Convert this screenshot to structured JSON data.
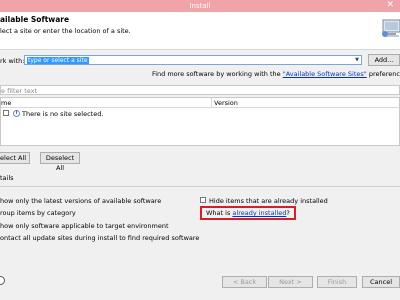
{
  "window": {
    "title": "Install",
    "close_glyph": "✕"
  },
  "header": {
    "title": "ailable Software",
    "subtitle": "lect a site or enter the location of a site.",
    "icon": "install-wizard-icon"
  },
  "work_with": {
    "label": "rk with:",
    "placeholder": "type or select a site",
    "add_label": "Add..."
  },
  "find_more": {
    "prefix": "Find more software by working with the ",
    "link": "\"Available Software Sites\"",
    "suffix": " preferenc"
  },
  "filter": {
    "placeholder": "e filter text"
  },
  "table": {
    "columns": [
      "me",
      "Version"
    ],
    "message": "There is no site selected."
  },
  "buttons": {
    "select_all": "Select All",
    "deselect_all": "Deselect All"
  },
  "details": {
    "label": "tails"
  },
  "options": {
    "latest_versions": "how only the latest versions of available software",
    "hide_installed": "Hide items that are already installed",
    "group_by_category": "roup items by category",
    "what_prefix": "What is ",
    "what_link": "already installed",
    "what_suffix": "?",
    "target_env": "how only software applicable to target environment",
    "contact_all": "ontact all update sites during install to find required software"
  },
  "footer": {
    "back": "< Back",
    "next": "Next >",
    "finish": "Finish",
    "cancel": "Cancel"
  },
  "colors": {
    "titlebar": "#f0a3a8",
    "highlight_box": "#d31f2a",
    "link": "#0033cc",
    "selection": "#3399ff"
  }
}
